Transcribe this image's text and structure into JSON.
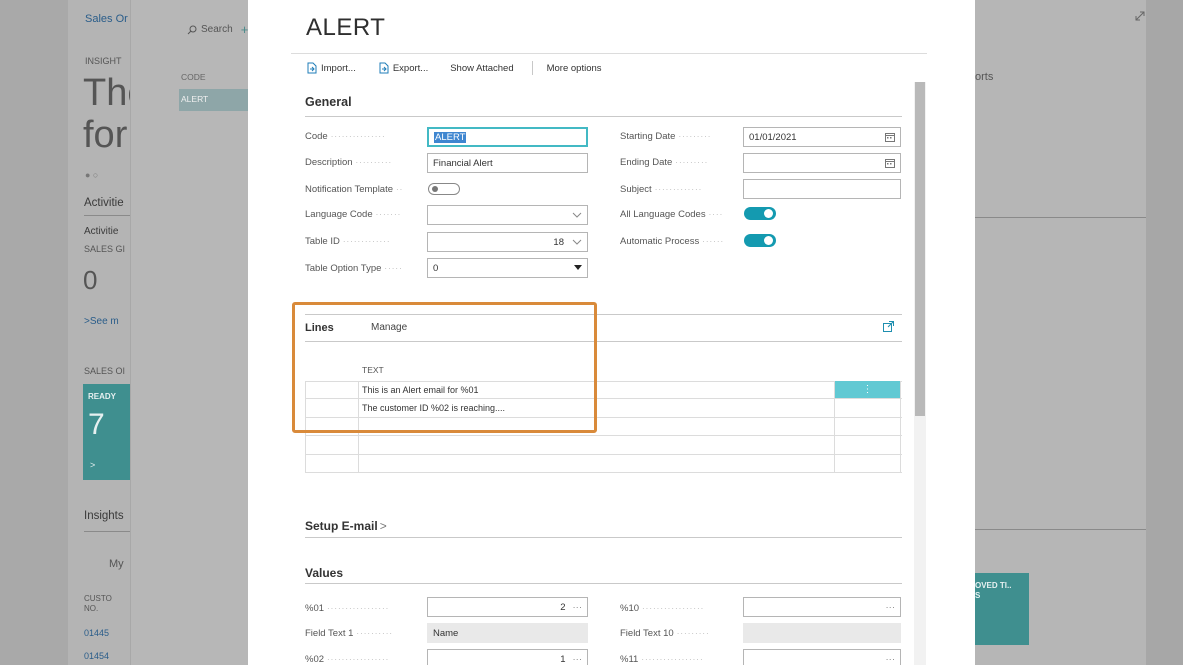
{
  "background": {
    "left": {
      "title": "Sales Or",
      "insight_label": "INSIGHT",
      "big_text_1": "The",
      "big_text_2": "for",
      "activities_1": "Activitie",
      "activities_2": "Activitie",
      "sales_gr": "SALES GI",
      "zero": "0",
      "see_more": ">See m",
      "sales_ord": "SALES OI",
      "ready": "READY",
      "seven": "7",
      "chev": ">",
      "insights": "Insights",
      "my": "My",
      "cust": "CUSTO",
      "no": "NO.",
      "row1": "01445",
      "row2": "01454"
    },
    "list": {
      "search": "Search",
      "plus": "+",
      "code_header": "CODE",
      "row_alert": "ALERT"
    },
    "right": {
      "reports": "orts",
      "tile_text_1": "OVED TI..",
      "tile_text_2": "S"
    }
  },
  "dialog": {
    "title": "ALERT",
    "actions": {
      "import": "Import...",
      "export": "Export...",
      "show_attached": "Show Attached",
      "more_options": "More options"
    },
    "general": {
      "title": "General",
      "code_label": "Code",
      "code_value": "ALERT",
      "description_label": "Description",
      "description_value": "Financial Alert",
      "notification_template_label": "Notification Template",
      "notification_template_on": false,
      "language_code_label": "Language Code",
      "language_code_value": "",
      "table_id_label": "Table ID",
      "table_id_value": "18",
      "table_option_type_label": "Table Option Type",
      "table_option_type_value": "0",
      "starting_date_label": "Starting Date",
      "starting_date_value": "01/01/2021",
      "ending_date_label": "Ending Date",
      "ending_date_value": "",
      "subject_label": "Subject",
      "subject_value": "",
      "all_language_codes_label": "All Language Codes",
      "all_language_codes_on": true,
      "automatic_process_label": "Automatic Process",
      "automatic_process_on": true
    },
    "lines": {
      "title": "Lines",
      "manage": "Manage",
      "column_text": "TEXT",
      "rows": [
        "This is an Alert email for %01",
        "The customer ID %02 is reaching....",
        "",
        "",
        ""
      ],
      "row_menu": "⋮"
    },
    "setup_email": {
      "title": "Setup E-mail",
      "chevron": ">"
    },
    "values": {
      "title": "Values",
      "v01_label": "%01",
      "v01_value": "2",
      "field_text_1_label": "Field Text 1",
      "field_text_1_value": "Name",
      "v02_label": "%02",
      "v02_value": "1",
      "v10_label": "%10",
      "v10_value": "",
      "field_text_10_label": "Field Text 10",
      "field_text_10_value": "",
      "v11_label": "%11",
      "v11_value": "",
      "ellipsis": "···"
    }
  },
  "colors": {
    "accent_teal": "#149ab0",
    "highlight_orange": "#d98a3a",
    "tile_teal": "#3f8f8f"
  }
}
